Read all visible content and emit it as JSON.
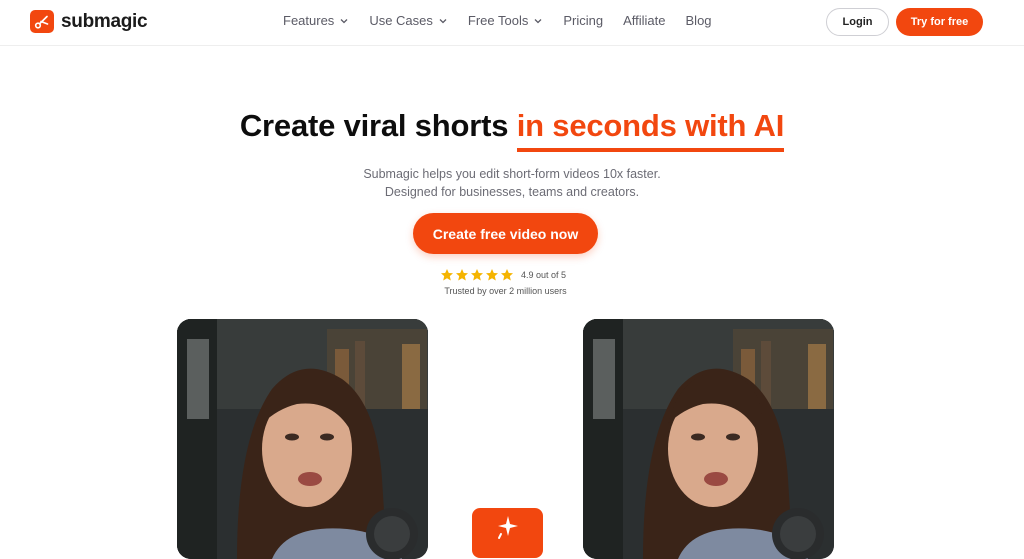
{
  "brand": {
    "name": "submagic",
    "accent_color": "#f2470f"
  },
  "nav": {
    "items": [
      {
        "label": "Features",
        "has_dropdown": true
      },
      {
        "label": "Use Cases",
        "has_dropdown": true
      },
      {
        "label": "Free Tools",
        "has_dropdown": true
      },
      {
        "label": "Pricing",
        "has_dropdown": false
      },
      {
        "label": "Affiliate",
        "has_dropdown": false
      },
      {
        "label": "Blog",
        "has_dropdown": false
      }
    ],
    "login_label": "Login",
    "try_label": "Try for free"
  },
  "hero": {
    "title_main": "Create viral shorts",
    "title_accent": "in seconds with AI",
    "subtitle_line1": "Submagic helps you edit short-form videos 10x faster.",
    "subtitle_line2": "Designed for businesses, teams and creators.",
    "cta_label": "Create free video now",
    "rating_stars": 5,
    "rating_text": "4.9 out of 5",
    "trusted_text": "Trusted by over 2 million users"
  },
  "icons": {
    "logo": "scissors-logo-icon",
    "dropdown": "chevron-down-icon",
    "rating": "star-icon",
    "badge": "sparkle-icon"
  }
}
